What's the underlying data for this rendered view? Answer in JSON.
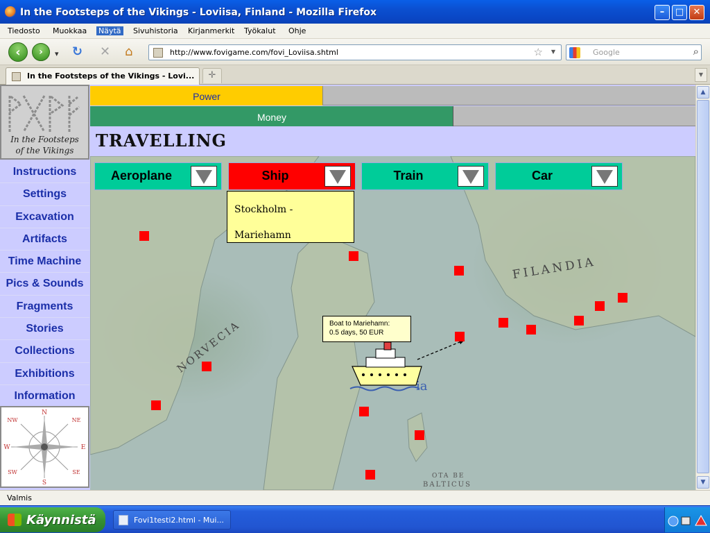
{
  "window": {
    "title": "In the Footsteps of the Vikings - Loviisa, Finland - Mozilla Firefox",
    "minimize_glyph": "–",
    "maximize_glyph": "□",
    "close_glyph": "✕"
  },
  "menu": {
    "items": [
      "Tiedosto",
      "Muokkaa",
      "Näytä",
      "Sivuhistoria",
      "Kirjanmerkit",
      "Työkalut",
      "Ohje"
    ],
    "active_index": 2
  },
  "toolbar": {
    "back_glyph": "‹",
    "forward_glyph": "›",
    "dropdown_glyph": "▾",
    "reload_glyph": "↻",
    "stop_glyph": "✕",
    "home_glyph": "⌂",
    "url": "http://www.fovigame.com/fovi_Loviisa.shtml",
    "bookmark_star_glyph": "☆",
    "url_dropdown_glyph": "▼",
    "search_placeholder": "Google",
    "search_glyph": "⌕"
  },
  "tabs": {
    "items": [
      {
        "label": "In the Footsteps of the Vikings - Lovi..."
      }
    ],
    "new_tab_glyph": "✛",
    "scroll_glyph": "▼"
  },
  "logo": {
    "caption_line1": "In the Footsteps",
    "caption_line2": "of the Vikings"
  },
  "sidebar": {
    "items": [
      "Instructions",
      "Settings",
      "Excavation",
      "Artifacts",
      "Time Machine",
      "Pics & Sounds",
      "Fragments",
      "Stories",
      "Collections",
      "Exhibitions",
      "Information"
    ]
  },
  "compass": {
    "n": "N",
    "ne": "NE",
    "e": "E",
    "se": "SE",
    "s": "S",
    "sw": "SW",
    "w": "W",
    "nw": "NW"
  },
  "meters": {
    "power_label": "Power",
    "power_level": 0.385,
    "money_label": "Money",
    "money_level": 0.6
  },
  "page": {
    "heading": "TRAVELLING"
  },
  "transport": {
    "modes": [
      {
        "label": "Aeroplane",
        "color": "#00cc99"
      },
      {
        "label": "Ship",
        "color": "#ff0000"
      },
      {
        "label": "Train",
        "color": "#00cc99"
      },
      {
        "label": "Car",
        "color": "#00cc99"
      }
    ],
    "selected": "Ship",
    "ship_dropdown": {
      "line1": "Stockholm -",
      "line2": "Mariehamn"
    }
  },
  "map": {
    "labels": {
      "finland": "FILANDIA",
      "norway": "NORVECIA",
      "baltic_line1": "OTA BE",
      "baltic_line2": "BALTICUS",
      "partial": "ia"
    },
    "tooltip": {
      "line1": "Boat to Mariehamn:",
      "line2": "0.5 days, 50 EUR"
    }
  },
  "status": {
    "text": "Valmis"
  },
  "taskbar": {
    "start_label": "Käynnistä",
    "task_label": "Fovi1testi2.html - Mui..."
  },
  "colors": {
    "power": "#ffcc00",
    "money": "#339966",
    "marker": "#ff0000",
    "sidebar_text": "#1a2ea8",
    "page_bg": "#ccccff"
  }
}
